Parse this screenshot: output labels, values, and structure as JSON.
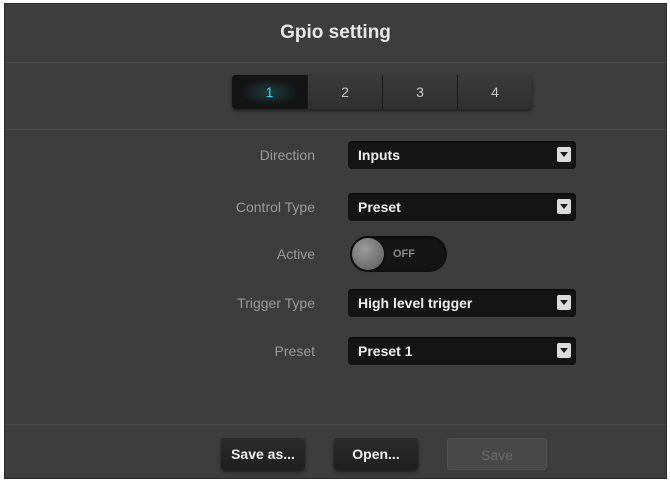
{
  "dialog": {
    "title": "Gpio setting"
  },
  "tabs": [
    {
      "label": "1",
      "active": true
    },
    {
      "label": "2",
      "active": false
    },
    {
      "label": "3",
      "active": false
    },
    {
      "label": "4",
      "active": false
    }
  ],
  "fields": {
    "direction": {
      "label": "Direction",
      "value": "Inputs"
    },
    "control_type": {
      "label": "Control Type",
      "value": "Preset"
    },
    "active": {
      "label": "Active",
      "state": "OFF"
    },
    "trigger_type": {
      "label": "Trigger Type",
      "value": "High level trigger"
    },
    "preset": {
      "label": "Preset",
      "value": "Preset 1"
    }
  },
  "buttons": {
    "save_as": "Save as...",
    "open": "Open...",
    "save": "Save"
  },
  "colors": {
    "background": "#3d3d3d",
    "active_tab_text": "#2fd7e6",
    "field_bg": "#151515"
  }
}
